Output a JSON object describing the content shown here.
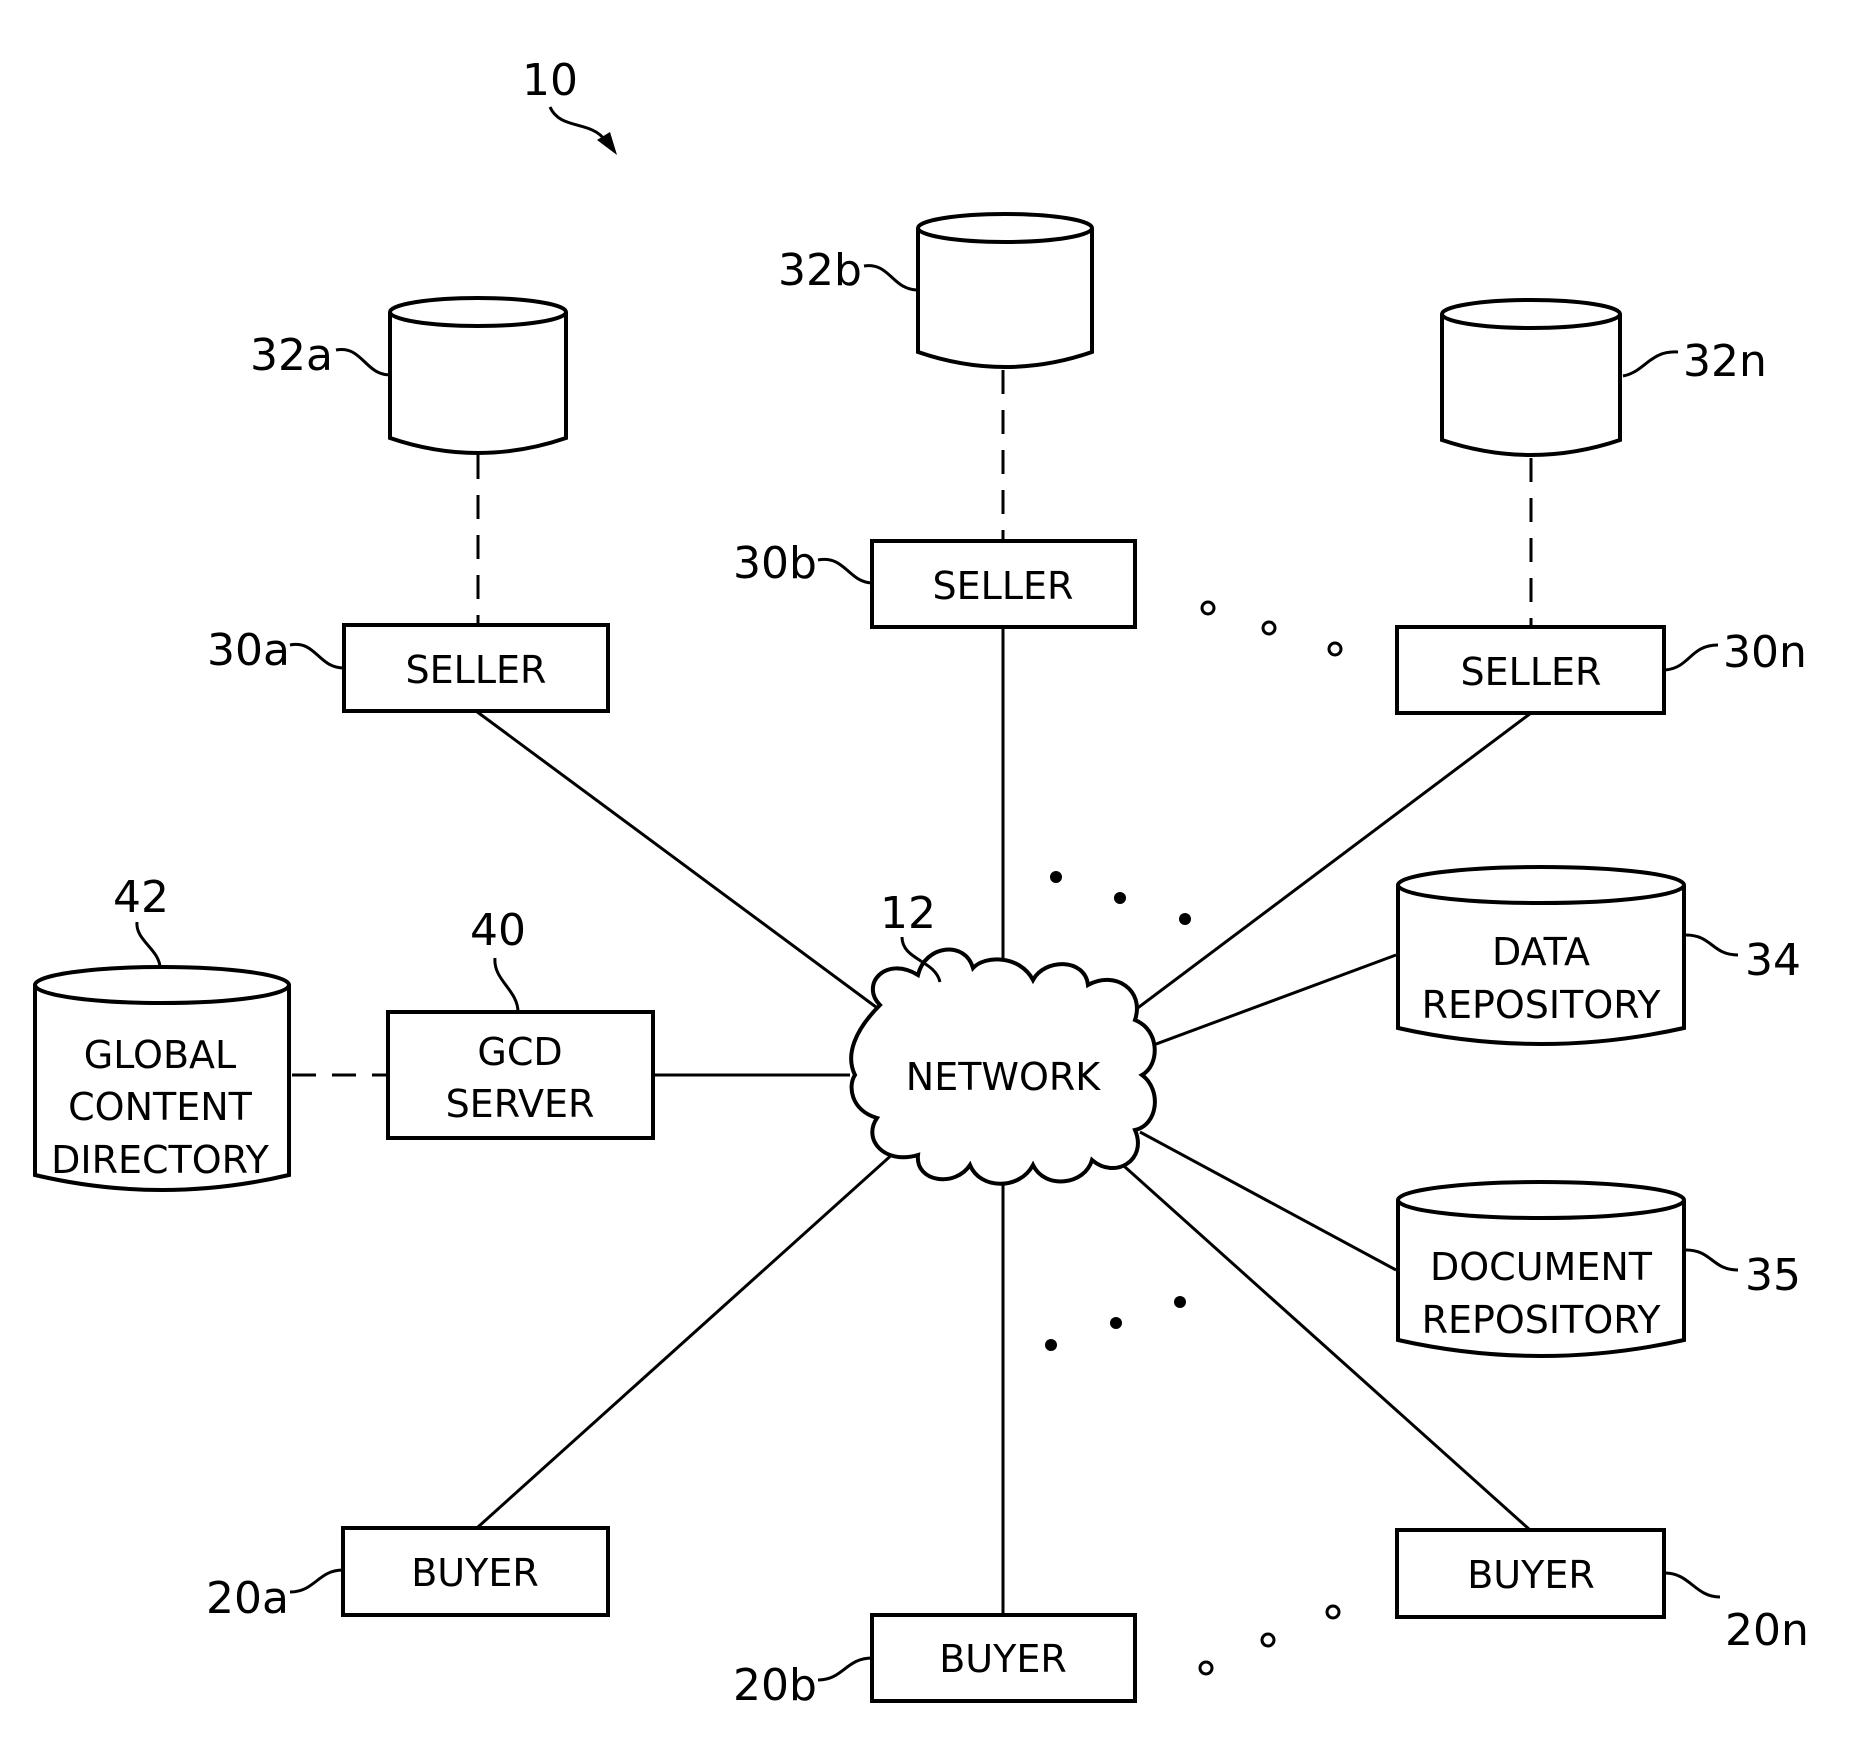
{
  "figure": {
    "reference": "10",
    "network": {
      "ref": "12",
      "label": "NETWORK"
    },
    "sellers": [
      {
        "ref": "30a",
        "label": "SELLER",
        "db_ref": "32a"
      },
      {
        "ref": "30b",
        "label": "SELLER",
        "db_ref": "32b"
      },
      {
        "ref": "30n",
        "label": "SELLER",
        "db_ref": "32n"
      }
    ],
    "buyers": [
      {
        "ref": "20a",
        "label": "BUYER"
      },
      {
        "ref": "20b",
        "label": "BUYER"
      },
      {
        "ref": "20n",
        "label": "BUYER"
      }
    ],
    "gcd_server": {
      "ref": "40",
      "lines": [
        "GCD",
        "SERVER"
      ]
    },
    "global_content_directory": {
      "ref": "42",
      "lines": [
        "GLOBAL",
        "CONTENT",
        "DIRECTORY"
      ]
    },
    "data_repository": {
      "ref": "34",
      "lines": [
        "DATA",
        "REPOSITORY"
      ]
    },
    "document_repository": {
      "ref": "35",
      "lines": [
        "DOCUMENT",
        "REPOSITORY"
      ]
    }
  }
}
